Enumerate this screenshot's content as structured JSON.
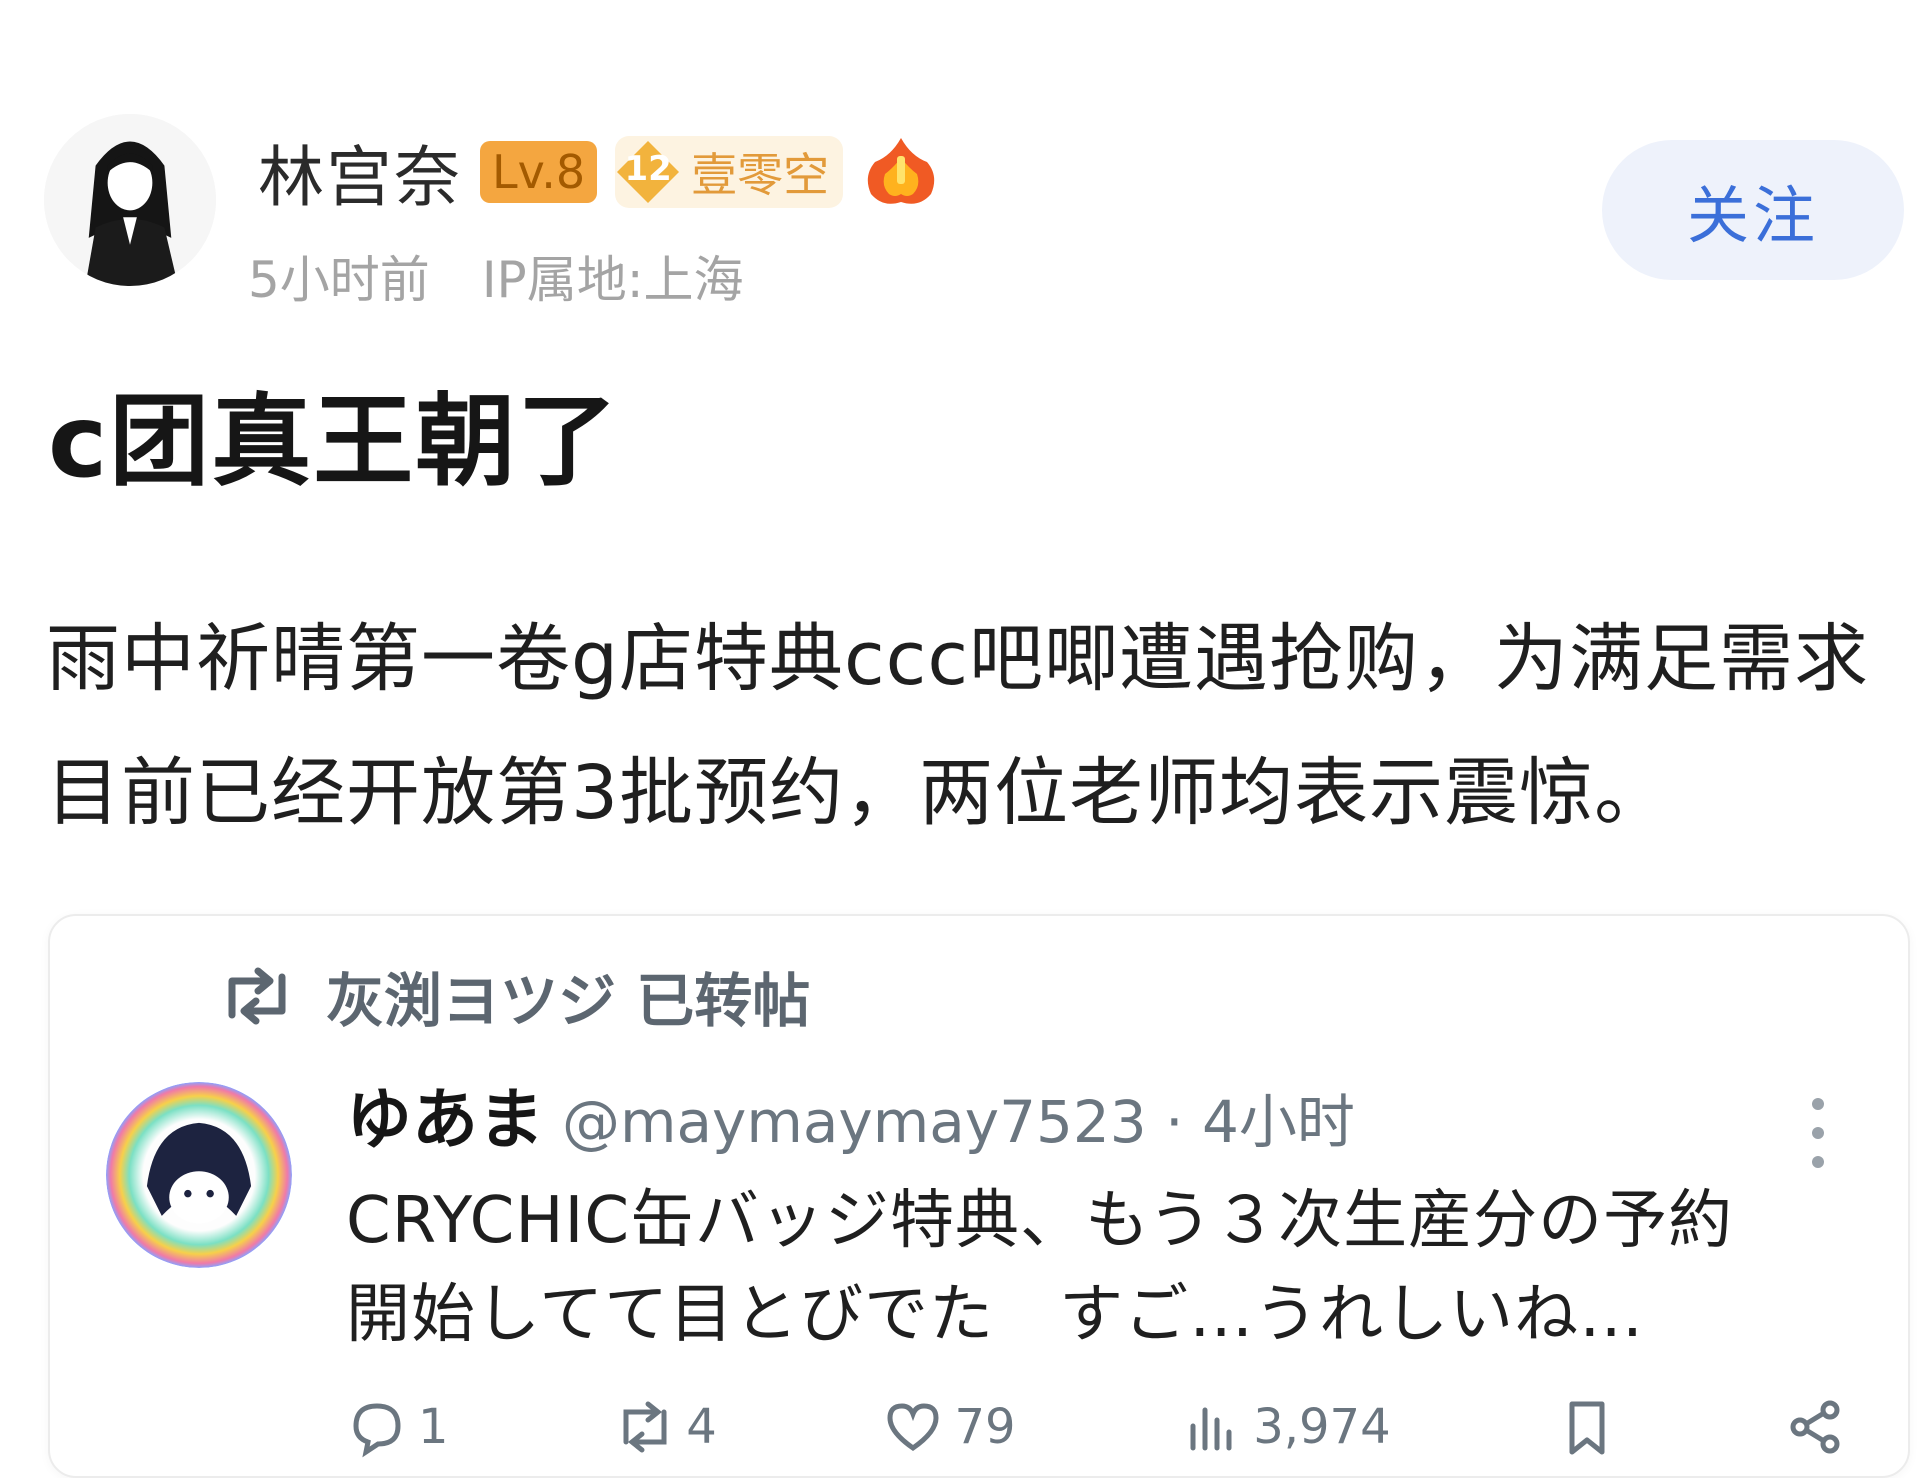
{
  "author": {
    "name": "林宫奈",
    "level": "Lv.8",
    "medal_level": "12",
    "medal_name": "壹零空",
    "time_ago": "5小时前",
    "ip_location": "IP属地:上海"
  },
  "follow_label": "关注",
  "post": {
    "title": "c团真王朝了",
    "body": "雨中祈晴第一卷g店特典ccc吧唧遭遇抢购，为满足需求目前已经开放第3批预约，两位老师均表示震惊。"
  },
  "embedded_tweet": {
    "retweeted_by": "灰渕ヨツジ 已转帖",
    "name": "ゆあま",
    "handle_time": "@maymaymay7523 · 4小时",
    "text_line1": "CRYCHIC缶バッジ特典、もう３次生産分の予約",
    "text_line2": "開始してて目とびでた　すご…うれしいね…",
    "actions": {
      "replies": "1",
      "retweets": "4",
      "likes": "79",
      "views": "3,974"
    }
  },
  "colors": {
    "accent_blue": "#3b6fd9",
    "level_orange": "#f4a640",
    "medal_gold": "#e29a3a",
    "meta_gray": "#a4a4a4"
  }
}
